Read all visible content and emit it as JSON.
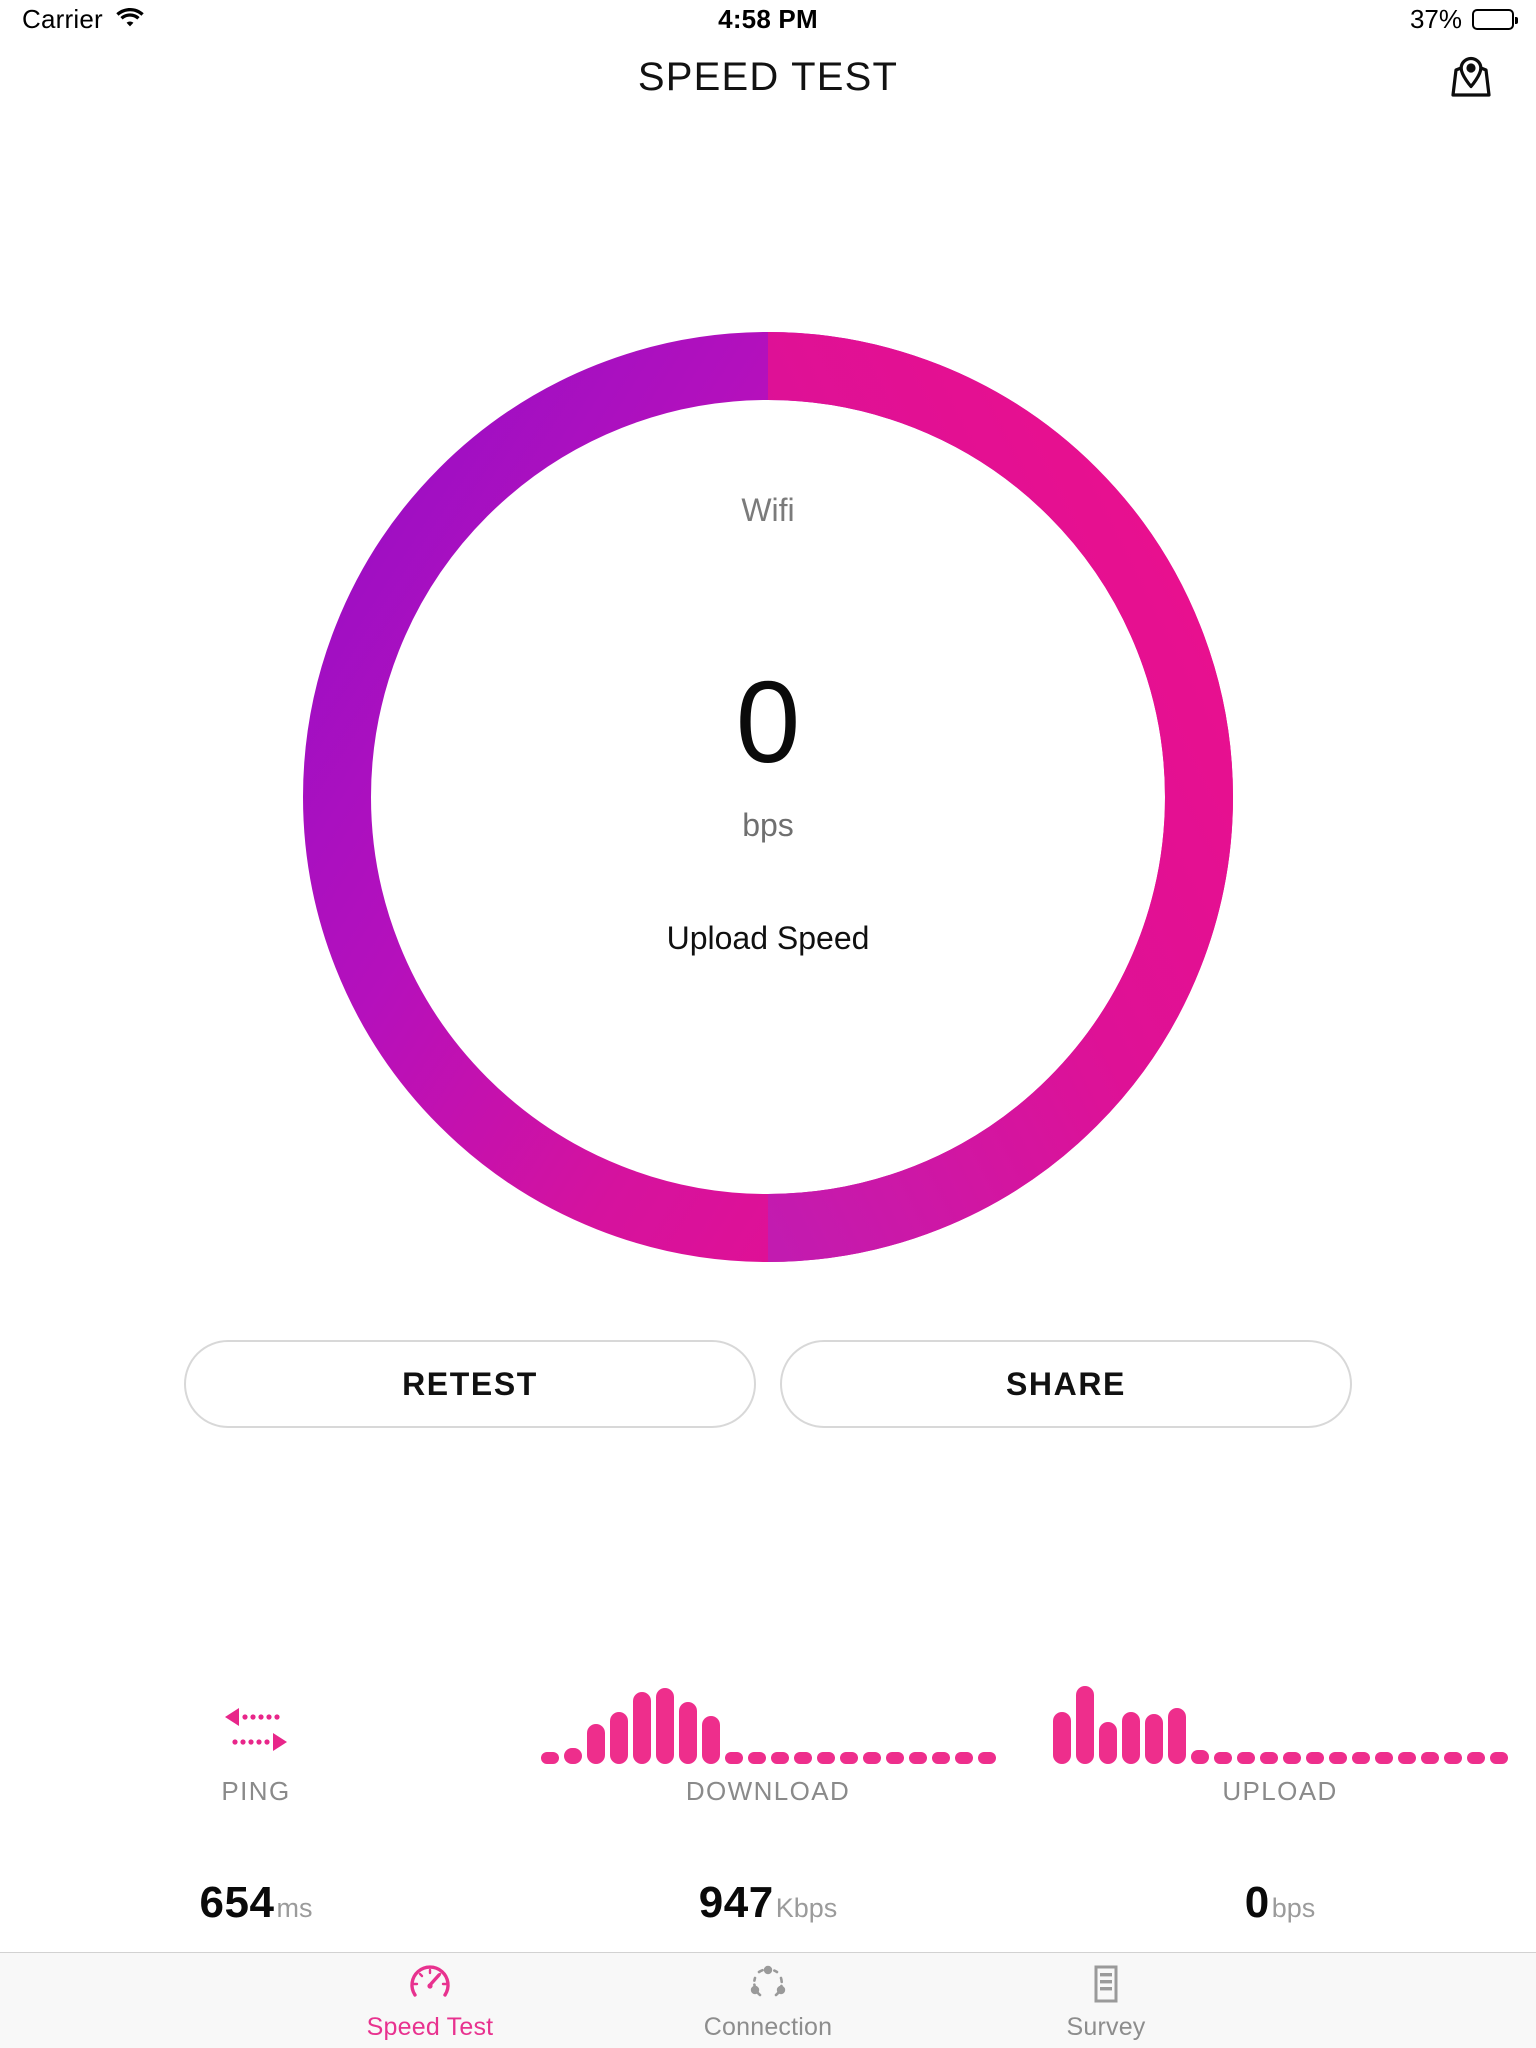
{
  "status_bar": {
    "carrier": "Carrier",
    "wifi_icon": "wifi-icon",
    "time": "4:58 PM",
    "battery_percent": "37%",
    "battery_level": 37
  },
  "nav_bar": {
    "title": "SPEED TEST",
    "right_action_icon": "map-pin-icon"
  },
  "gauge": {
    "connection_type": "Wifi",
    "value": "0",
    "unit": "bps",
    "label": "Upload Speed",
    "ring_gradient_start": "#A30FC0",
    "ring_gradient_end": "#EC0F8C",
    "progress_percent": 100
  },
  "actions": {
    "retest_label": "RETEST",
    "share_label": "SHARE"
  },
  "metrics": [
    {
      "id": "ping",
      "name": "PING",
      "icon": "ping-arrows-icon",
      "value": "654",
      "unit": "ms",
      "bars": []
    },
    {
      "id": "download",
      "name": "DOWNLOAD",
      "icon": "download-histogram-icon",
      "value": "947",
      "unit": "Kbps",
      "bars": [
        12,
        16,
        40,
        52,
        72,
        76,
        62,
        48,
        12,
        12,
        12,
        12,
        12,
        12,
        12,
        12,
        12,
        12,
        12,
        12
      ]
    },
    {
      "id": "upload",
      "name": "UPLOAD",
      "icon": "upload-histogram-icon",
      "value": "0",
      "unit": "bps",
      "bars": [
        52,
        78,
        42,
        52,
        50,
        56,
        14,
        12,
        12,
        12,
        12,
        12,
        12,
        12,
        12,
        12,
        12,
        12,
        12,
        12
      ]
    }
  ],
  "bar_color": "#EE2E8C",
  "tab_bar": {
    "active_color": "#E8328F",
    "inactive_color": "#8D8D8D",
    "tabs": [
      {
        "id": "speed-test",
        "label": "Speed Test",
        "icon": "gauge-icon",
        "active": true
      },
      {
        "id": "connection",
        "label": "Connection",
        "icon": "network-nodes-icon",
        "active": false
      },
      {
        "id": "survey",
        "label": "Survey",
        "icon": "document-lines-icon",
        "active": false
      }
    ]
  }
}
